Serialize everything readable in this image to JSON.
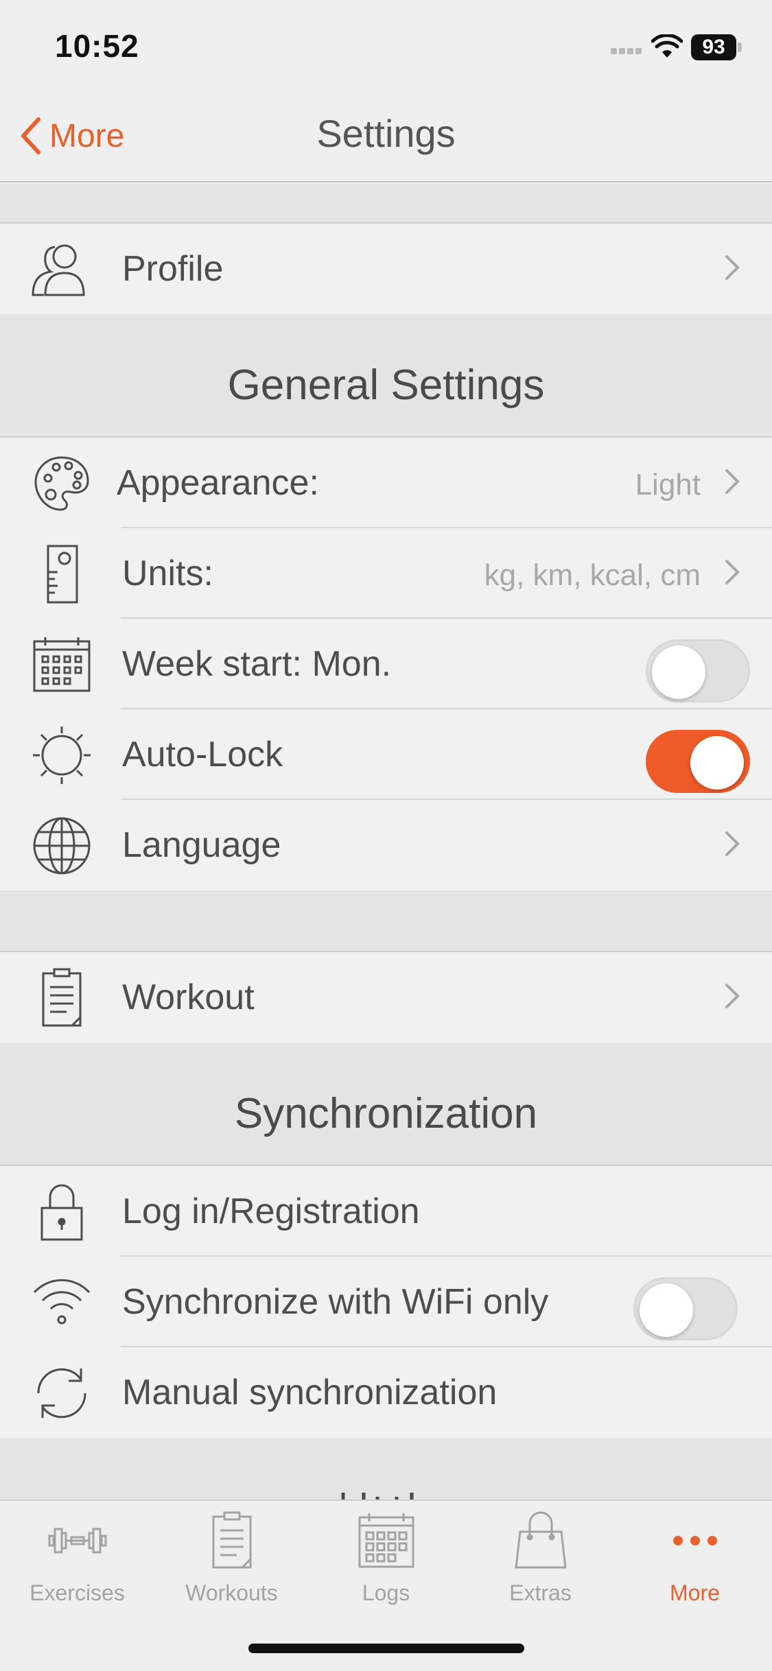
{
  "status": {
    "time": "10:52",
    "battery": "93"
  },
  "nav": {
    "back_label": "More",
    "title": "Settings"
  },
  "profile": {
    "label": "Profile",
    "icon": "profile-icon"
  },
  "general": {
    "title": "General Settings",
    "appearance": {
      "label": "Appearance:",
      "value": "Light"
    },
    "units": {
      "label": "Units:",
      "value": "kg, km, kcal, cm"
    },
    "week_start": {
      "label": "Week start: Mon.",
      "toggle": false
    },
    "auto_lock": {
      "label": "Auto-Lock",
      "toggle": true
    },
    "language": {
      "label": "Language"
    }
  },
  "workout": {
    "label": "Workout"
  },
  "sync": {
    "title": "Synchronization",
    "login": {
      "label": "Log in/Registration"
    },
    "wifi_only": {
      "label": "Synchronize with WiFi only",
      "toggle": false
    },
    "manual": {
      "label": "Manual synchronization"
    }
  },
  "tabs": [
    {
      "label": "Exercises",
      "icon": "dumbbell-icon"
    },
    {
      "label": "Workouts",
      "icon": "clipboard-icon"
    },
    {
      "label": "Logs",
      "icon": "calendar-icon"
    },
    {
      "label": "Extras",
      "icon": "shopping-bag-icon"
    },
    {
      "label": "More",
      "icon": "more-dots-icon",
      "active": true
    }
  ],
  "colors": {
    "accent": "#e8602c",
    "toggle_on": "#ee5a28",
    "background": "#efefef",
    "band": "#e4e4e4"
  }
}
